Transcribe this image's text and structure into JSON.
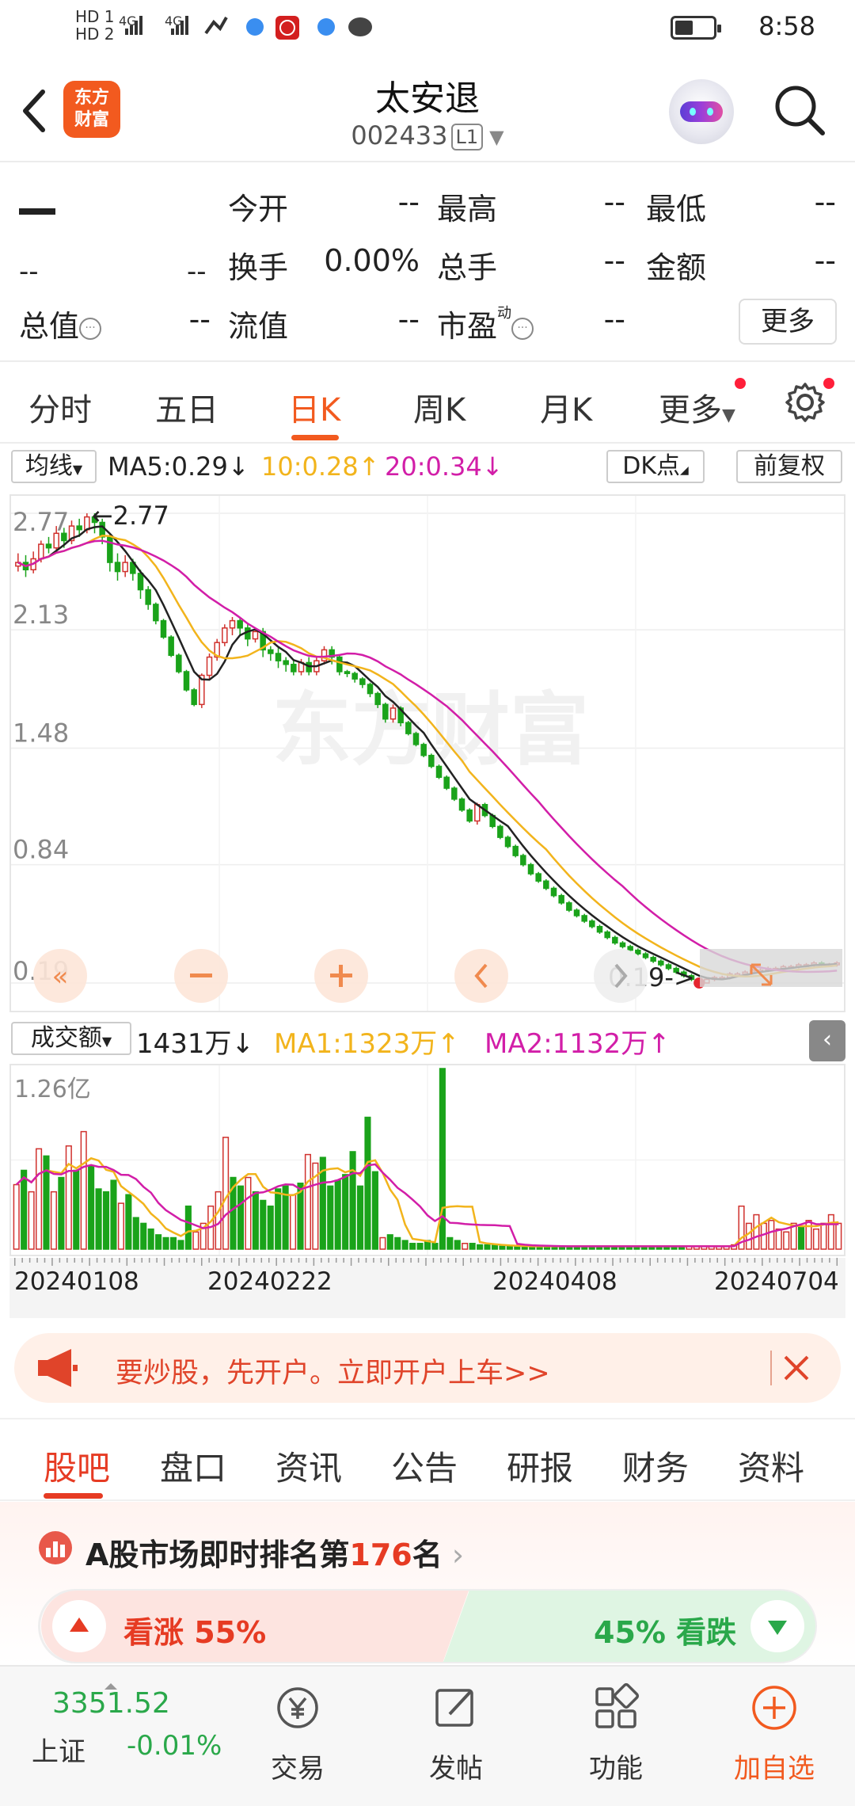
{
  "status_bar": {
    "time": "8:58",
    "net1": "HD 1",
    "net2": "HD 2",
    "gen1": "4G",
    "gen2": "4G",
    "battery_icon": "battery-icon",
    "battery_level": 0.4
  },
  "header": {
    "app_logo_line1": "东方",
    "app_logo_line2": "财富",
    "title": "太安退",
    "code": "002433",
    "level": "L1"
  },
  "quote": {
    "price": "",
    "change": "--",
    "change_pct": "--",
    "open_label": "今开",
    "open_value": "--",
    "high_label": "最高",
    "high_value": "--",
    "low_label": "最低",
    "low_value": "--",
    "turnover_label": "换手",
    "turnover_value": "0.00%",
    "volume_label": "总手",
    "volume_value": "--",
    "amount_label": "金额",
    "amount_value": "--",
    "mktcap_label": "总值",
    "mktcap_value": "--",
    "float_label": "流值",
    "float_value": "--",
    "pe_label": "市盈",
    "pe_sup": "动",
    "pe_value": "--",
    "more_label": "更多"
  },
  "period_tabs": {
    "items": [
      "分时",
      "五日",
      "日K",
      "周K",
      "月K",
      "更多"
    ],
    "active": "日K"
  },
  "ma_row": {
    "mode": "均线",
    "ma5": "MA5:0.29",
    "ma10": "10:0.28",
    "ma20": "20:0.34",
    "dk_label": "DK点",
    "adjust_label": "前复权",
    "ma5_color": "#222222",
    "ma10_color": "#f2b41c",
    "ma20_color": "#d21ea8"
  },
  "chart_controls": [
    "rewind-icon",
    "zoom-out-icon",
    "zoom-in-icon",
    "prev-icon",
    "next-icon",
    "fullscreen-icon"
  ],
  "chart_data": [
    {
      "type": "candlestick",
      "y_ticks": [
        "2.77",
        "2.13",
        "1.48",
        "0.84",
        "0.19"
      ],
      "ylim": [
        0.19,
        2.77
      ],
      "high_label": "2.77",
      "low_label": "0.19",
      "watermark": "东方财富",
      "candles": [
        [
          2.48,
          2.5,
          2.45,
          2.55
        ],
        [
          2.5,
          2.46,
          2.42,
          2.54
        ],
        [
          2.46,
          2.52,
          2.44,
          2.56
        ],
        [
          2.52,
          2.6,
          2.5,
          2.62
        ],
        [
          2.6,
          2.58,
          2.55,
          2.64
        ],
        [
          2.58,
          2.66,
          2.56,
          2.7
        ],
        [
          2.66,
          2.62,
          2.58,
          2.69
        ],
        [
          2.62,
          2.7,
          2.6,
          2.73
        ],
        [
          2.7,
          2.68,
          2.64,
          2.74
        ],
        [
          2.68,
          2.75,
          2.66,
          2.77
        ],
        [
          2.75,
          2.72,
          2.66,
          2.77
        ],
        [
          2.72,
          2.64,
          2.6,
          2.74
        ],
        [
          2.64,
          2.5,
          2.45,
          2.66
        ],
        [
          2.5,
          2.45,
          2.4,
          2.55
        ],
        [
          2.45,
          2.5,
          2.42,
          2.54
        ],
        [
          2.5,
          2.44,
          2.4,
          2.52
        ],
        [
          2.44,
          2.35,
          2.3,
          2.46
        ],
        [
          2.35,
          2.27,
          2.24,
          2.37
        ],
        [
          2.27,
          2.18,
          2.16,
          2.28
        ],
        [
          2.18,
          2.09,
          2.08,
          2.19
        ],
        [
          2.09,
          1.99,
          1.98,
          2.1
        ],
        [
          1.99,
          1.9,
          1.89,
          2.0
        ],
        [
          1.9,
          1.8,
          1.79,
          1.91
        ],
        [
          1.8,
          1.72,
          1.71,
          1.81
        ],
        [
          1.72,
          1.88,
          1.7,
          1.89
        ],
        [
          1.88,
          1.98,
          1.86,
          2.0
        ],
        [
          1.98,
          2.06,
          1.96,
          2.08
        ],
        [
          2.06,
          2.14,
          2.04,
          2.16
        ],
        [
          2.14,
          2.18,
          2.1,
          2.2
        ],
        [
          2.18,
          2.14,
          2.1,
          2.2
        ],
        [
          2.14,
          2.08,
          2.04,
          2.16
        ],
        [
          2.08,
          2.12,
          2.06,
          2.14
        ],
        [
          2.12,
          2.02,
          1.98,
          2.14
        ],
        [
          2.02,
          2.0,
          1.96,
          2.04
        ],
        [
          2.0,
          1.96,
          1.92,
          2.03
        ],
        [
          1.96,
          1.94,
          1.9,
          1.98
        ],
        [
          1.94,
          1.9,
          1.88,
          1.96
        ],
        [
          1.9,
          1.95,
          1.88,
          1.97
        ],
        [
          1.95,
          1.9,
          1.88,
          1.98
        ],
        [
          1.9,
          1.96,
          1.88,
          1.98
        ],
        [
          1.96,
          2.02,
          1.94,
          2.04
        ],
        [
          2.02,
          1.98,
          1.94,
          2.04
        ],
        [
          1.98,
          1.9,
          1.88,
          1.99
        ],
        [
          1.9,
          1.89,
          1.87,
          1.91
        ],
        [
          1.89,
          1.86,
          1.84,
          1.9
        ],
        [
          1.86,
          1.83,
          1.81,
          1.87
        ],
        [
          1.83,
          1.78,
          1.76,
          1.84
        ],
        [
          1.78,
          1.72,
          1.7,
          1.79
        ],
        [
          1.72,
          1.64,
          1.62,
          1.73
        ],
        [
          1.64,
          1.7,
          1.62,
          1.72
        ],
        [
          1.7,
          1.62,
          1.6,
          1.71
        ],
        [
          1.62,
          1.56,
          1.55,
          1.63
        ],
        [
          1.56,
          1.5,
          1.49,
          1.57
        ],
        [
          1.5,
          1.44,
          1.43,
          1.51
        ],
        [
          1.44,
          1.38,
          1.37,
          1.45
        ],
        [
          1.38,
          1.32,
          1.31,
          1.39
        ],
        [
          1.32,
          1.26,
          1.25,
          1.33
        ],
        [
          1.26,
          1.2,
          1.19,
          1.27
        ],
        [
          1.2,
          1.14,
          1.13,
          1.21
        ],
        [
          1.14,
          1.08,
          1.07,
          1.15
        ],
        [
          1.08,
          1.17,
          1.06,
          1.18
        ],
        [
          1.17,
          1.11,
          1.1,
          1.18
        ],
        [
          1.11,
          1.05,
          1.04,
          1.12
        ],
        [
          1.05,
          0.99,
          0.98,
          1.06
        ],
        [
          0.99,
          0.94,
          0.93,
          1.0
        ],
        [
          0.94,
          0.89,
          0.88,
          0.95
        ],
        [
          0.89,
          0.84,
          0.83,
          0.9
        ],
        [
          0.84,
          0.79,
          0.78,
          0.85
        ],
        [
          0.79,
          0.75,
          0.74,
          0.8
        ],
        [
          0.75,
          0.71,
          0.7,
          0.76
        ],
        [
          0.71,
          0.67,
          0.66,
          0.72
        ],
        [
          0.67,
          0.63,
          0.62,
          0.68
        ],
        [
          0.63,
          0.59,
          0.58,
          0.64
        ],
        [
          0.59,
          0.56,
          0.55,
          0.6
        ],
        [
          0.56,
          0.53,
          0.52,
          0.57
        ],
        [
          0.53,
          0.5,
          0.49,
          0.54
        ],
        [
          0.5,
          0.47,
          0.46,
          0.51
        ],
        [
          0.47,
          0.44,
          0.43,
          0.48
        ],
        [
          0.44,
          0.41,
          0.4,
          0.45
        ],
        [
          0.41,
          0.39,
          0.38,
          0.42
        ],
        [
          0.39,
          0.37,
          0.36,
          0.4
        ],
        [
          0.37,
          0.35,
          0.34,
          0.38
        ],
        [
          0.35,
          0.33,
          0.32,
          0.36
        ],
        [
          0.33,
          0.31,
          0.3,
          0.34
        ],
        [
          0.31,
          0.29,
          0.28,
          0.32
        ],
        [
          0.29,
          0.27,
          0.26,
          0.3
        ],
        [
          0.27,
          0.25,
          0.24,
          0.28
        ],
        [
          0.25,
          0.23,
          0.22,
          0.26
        ],
        [
          0.23,
          0.21,
          0.2,
          0.24
        ],
        [
          0.21,
          0.19,
          0.19,
          0.22
        ],
        [
          0.19,
          0.21,
          0.19,
          0.22
        ],
        [
          0.21,
          0.22,
          0.2,
          0.23
        ],
        [
          0.22,
          0.22,
          0.21,
          0.23
        ],
        [
          0.22,
          0.24,
          0.21,
          0.25
        ],
        [
          0.24,
          0.24,
          0.23,
          0.25
        ],
        [
          0.24,
          0.25,
          0.23,
          0.26
        ],
        [
          0.25,
          0.26,
          0.24,
          0.27
        ],
        [
          0.26,
          0.26,
          0.25,
          0.27
        ],
        [
          0.26,
          0.27,
          0.25,
          0.28
        ],
        [
          0.27,
          0.27,
          0.26,
          0.28
        ],
        [
          0.27,
          0.28,
          0.26,
          0.29
        ],
        [
          0.28,
          0.28,
          0.27,
          0.29
        ],
        [
          0.28,
          0.29,
          0.27,
          0.3
        ],
        [
          0.29,
          0.29,
          0.28,
          0.3
        ],
        [
          0.29,
          0.3,
          0.28,
          0.31
        ],
        [
          0.3,
          0.29,
          0.28,
          0.31
        ],
        [
          0.29,
          0.29,
          0.28,
          0.3
        ],
        [
          0.29,
          0.3,
          0.28,
          0.31
        ]
      ],
      "series": [
        {
          "name": "MA5",
          "color": "#222222"
        },
        {
          "name": "MA10",
          "color": "#f2b41c"
        },
        {
          "name": "MA20",
          "color": "#d21ea8"
        }
      ]
    },
    {
      "type": "bar",
      "title": "成交额",
      "y_tick": "1.26亿",
      "current_label": "1431万",
      "ma1_label": "MA1:1323万",
      "ma2_label": "MA2:1132万",
      "x_ticks": [
        "20240108",
        "20240222",
        "20240408",
        "20240704"
      ],
      "volumes": [
        45,
        55,
        40,
        70,
        65,
        40,
        50,
        72,
        55,
        82,
        58,
        42,
        40,
        48,
        32,
        38,
        22,
        18,
        14,
        10,
        8,
        8,
        6,
        30,
        12,
        18,
        30,
        40,
        78,
        50,
        44,
        50,
        40,
        34,
        30,
        42,
        44,
        38,
        46,
        66,
        60,
        64,
        44,
        48,
        52,
        68,
        44,
        92,
        54,
        8,
        10,
        8,
        6,
        4,
        4,
        6,
        4,
        126,
        8,
        6,
        4,
        4,
        3,
        3,
        3,
        2,
        2,
        2,
        2,
        2,
        2,
        2,
        2,
        2,
        2,
        2,
        2,
        2,
        2,
        2,
        2,
        2,
        2,
        2,
        2,
        2,
        2,
        2,
        2,
        2,
        2,
        2,
        2,
        2,
        2,
        2,
        3,
        30,
        18,
        24,
        18,
        20,
        14,
        12,
        18,
        16,
        20,
        14,
        18,
        24,
        18
      ],
      "ylim": [
        0,
        126
      ]
    }
  ],
  "volume_row": {
    "mode": "成交额",
    "current": "1431万",
    "ma1": "MA1:1323万",
    "ma2": "MA2:1132万",
    "ma1_color": "#f2b41c",
    "ma2_color": "#d21ea8"
  },
  "banner": {
    "text": "要炒股，先开户。立即开户上车>>",
    "icon": "megaphone-icon",
    "close_icon": "close-icon"
  },
  "content_tabs": {
    "items": [
      "股吧",
      "盘口",
      "资讯",
      "公告",
      "研报",
      "财务",
      "资料"
    ],
    "active": "股吧"
  },
  "rank": {
    "prefix": "A股市场即时排名第",
    "number": "176",
    "suffix": "名",
    "bull_label": "看涨 55%",
    "bear_label": "45% 看跌",
    "bull_pct": 55,
    "bear_pct": 45
  },
  "bottom_nav": {
    "index_value": "3351.52",
    "index_name": "上证",
    "index_change": "-0.01%",
    "items": [
      "交易",
      "发帖",
      "功能",
      "加自选"
    ]
  }
}
